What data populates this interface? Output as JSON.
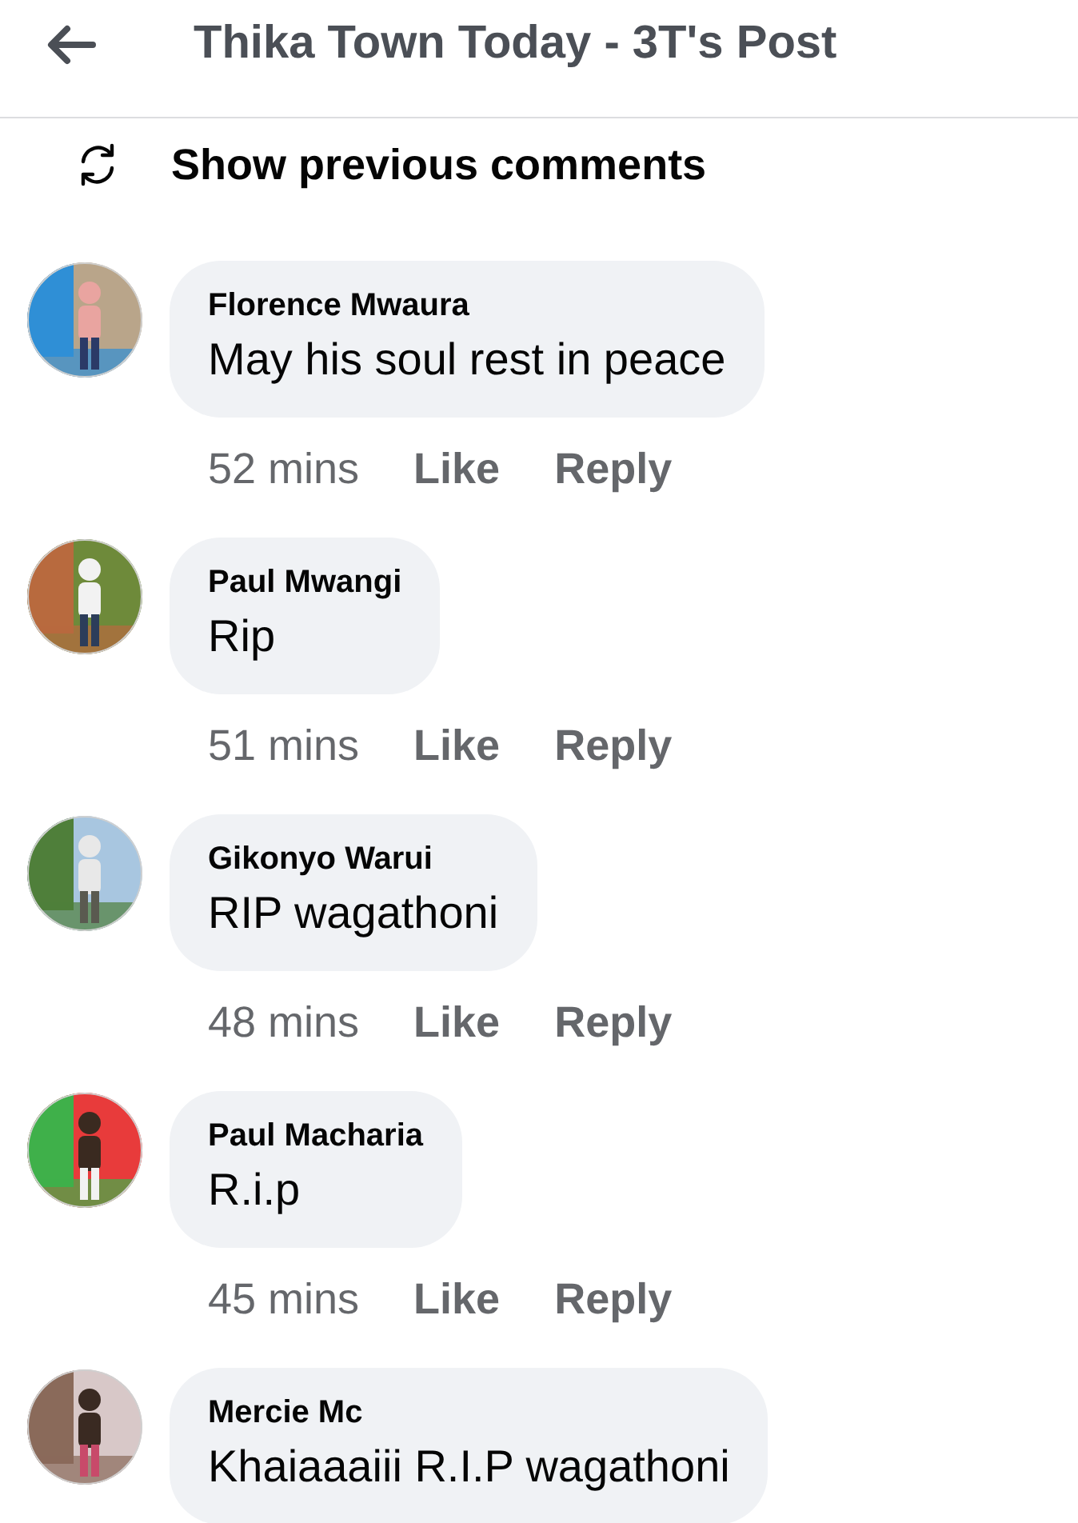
{
  "header": {
    "title": "Thika Town Today - 3T's Post"
  },
  "show_previous": {
    "label": "Show previous comments"
  },
  "comments": [
    {
      "name": "Florence Mwaura",
      "text": "May his soul rest in peace",
      "time": "52 mins",
      "actions": [
        "Like",
        "Reply"
      ]
    },
    {
      "name": "Paul Mwangi",
      "text": "Rip",
      "time": "51 mins",
      "actions": [
        "Like",
        "Reply"
      ]
    },
    {
      "name": "Gikonyo Warui",
      "text": "RIP wagathoni",
      "time": "48 mins",
      "actions": [
        "Like",
        "Reply"
      ]
    },
    {
      "name": "Paul Macharia",
      "text": "R.i.p",
      "time": "45 mins",
      "actions": [
        "Like",
        "Reply"
      ]
    },
    {
      "name": "Mercie Mc",
      "text": "Khaiaaaiii R.I.P wagathoni"
    }
  ]
}
